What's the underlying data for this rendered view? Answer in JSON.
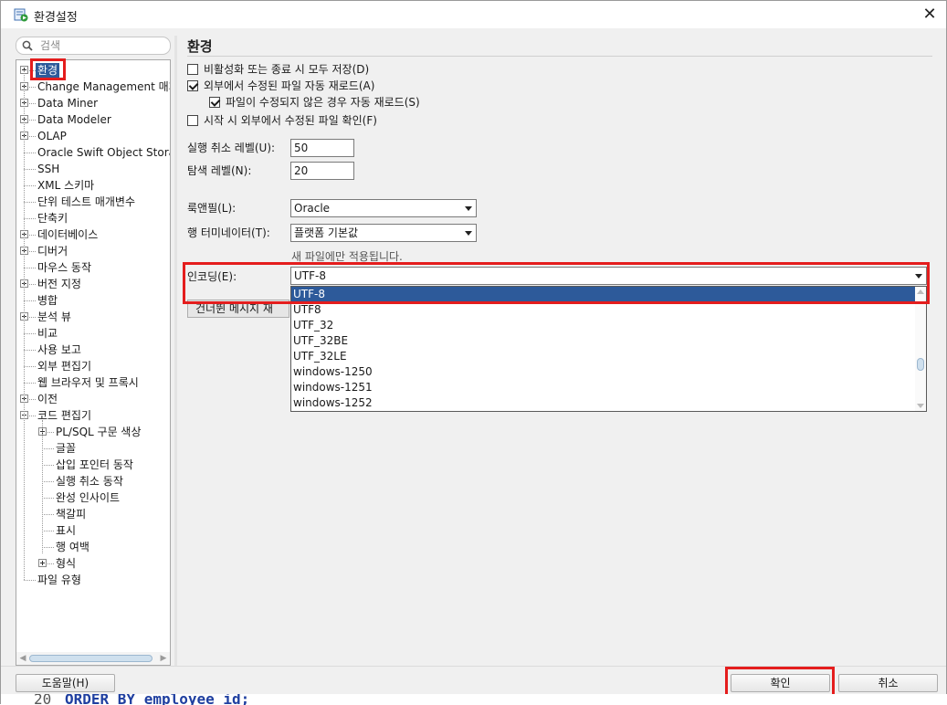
{
  "window": {
    "title": "환경설정"
  },
  "search": {
    "placeholder": "검색"
  },
  "tree": {
    "items": [
      {
        "label": "환경",
        "expander": "plus",
        "selected": true
      },
      {
        "label": "Change Management 매개",
        "expander": "plus"
      },
      {
        "label": "Data Miner",
        "expander": "plus"
      },
      {
        "label": "Data Modeler",
        "expander": "plus"
      },
      {
        "label": "OLAP",
        "expander": "plus"
      },
      {
        "label": "Oracle Swift Object Storag",
        "expander": "none"
      },
      {
        "label": "SSH",
        "expander": "none"
      },
      {
        "label": "XML 스키마",
        "expander": "none"
      },
      {
        "label": "단위 테스트 매개변수",
        "expander": "none"
      },
      {
        "label": "단축키",
        "expander": "none"
      },
      {
        "label": "데이터베이스",
        "expander": "plus"
      },
      {
        "label": "디버거",
        "expander": "plus"
      },
      {
        "label": "마우스 동작",
        "expander": "none"
      },
      {
        "label": "버전 지정",
        "expander": "plus"
      },
      {
        "label": "병합",
        "expander": "none"
      },
      {
        "label": "분석 뷰",
        "expander": "plus"
      },
      {
        "label": "비교",
        "expander": "none"
      },
      {
        "label": "사용 보고",
        "expander": "none"
      },
      {
        "label": "외부 편집기",
        "expander": "none"
      },
      {
        "label": "웹 브라우저 및 프록시",
        "expander": "none"
      },
      {
        "label": "이전",
        "expander": "plus"
      },
      {
        "label": "코드 편집기",
        "expander": "minus"
      },
      {
        "label": "PL/SQL 구문 색상",
        "expander": "plus",
        "child": true
      },
      {
        "label": "글꼴",
        "expander": "none",
        "child": true
      },
      {
        "label": "삽입 포인터 동작",
        "expander": "none",
        "child": true
      },
      {
        "label": "실행 취소 동작",
        "expander": "none",
        "child": true
      },
      {
        "label": "완성 인사이트",
        "expander": "none",
        "child": true
      },
      {
        "label": "책갈피",
        "expander": "none",
        "child": true
      },
      {
        "label": "표시",
        "expander": "none",
        "child": true
      },
      {
        "label": "행 여백",
        "expander": "none",
        "child": true
      },
      {
        "label": "형식",
        "expander": "plus",
        "child": true
      },
      {
        "label": "파일 유형",
        "expander": "none"
      }
    ]
  },
  "panel": {
    "title": "환경",
    "checkboxes": [
      {
        "label": "비활성화 또는 종료 시 모두 저장(D)",
        "checked": false
      },
      {
        "label": "외부에서 수정된 파일 자동 재로드(A)",
        "checked": true
      },
      {
        "label": "파일이 수정되지 않은 경우 자동 재로드(S)",
        "checked": true
      },
      {
        "label": "시작 시 외부에서 수정된 파일 확인(F)",
        "checked": false
      }
    ],
    "undo_level": {
      "label": "실행 취소 레벨(U):",
      "value": "50"
    },
    "nav_level": {
      "label": "탐색 레벨(N):",
      "value": "20"
    },
    "look_and_feel": {
      "label": "룩앤필(L):",
      "value": "Oracle"
    },
    "line_terminator": {
      "label": "행 터미네이터(T):",
      "value": "플랫폼 기본값"
    },
    "new_files_note": "새 파일에만 적용됩니다.",
    "encoding": {
      "label": "인코딩(E):",
      "value": "UTF-8",
      "options": [
        "UTF-8",
        "UTF8",
        "UTF_32",
        "UTF_32BE",
        "UTF_32LE",
        "windows-1250",
        "windows-1251",
        "windows-1252"
      ]
    },
    "hidden_button": "건너뛴 메시지 재"
  },
  "buttons": {
    "help": "도움말(H)",
    "ok": "확인",
    "cancel": "취소"
  },
  "background_editor": {
    "line_number": "20",
    "code": "ORDER BY employee_id;"
  },
  "colors": {
    "selection": "#2d5a9a",
    "highlight_box": "#e41d1d",
    "background": "#f0f0f0"
  }
}
